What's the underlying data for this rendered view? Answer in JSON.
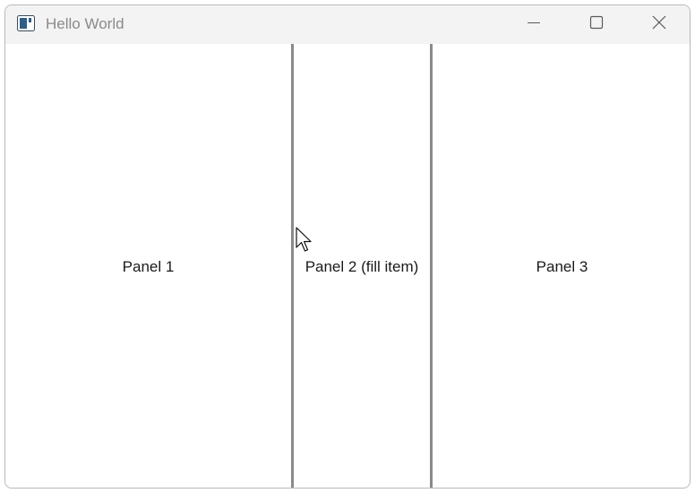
{
  "window": {
    "title": "Hello World",
    "icons": {
      "app": "app-window-icon",
      "minimize": "minimize-icon",
      "maximize": "maximize-icon",
      "close": "close-icon"
    }
  },
  "panels": [
    {
      "label": "Panel 1"
    },
    {
      "label": "Panel 2 (fill item)"
    },
    {
      "label": "Panel 3"
    }
  ],
  "colors": {
    "titlebar": "#f3f3f3",
    "splitter": "#8a8a8a",
    "title_text": "#8a8a8a"
  }
}
